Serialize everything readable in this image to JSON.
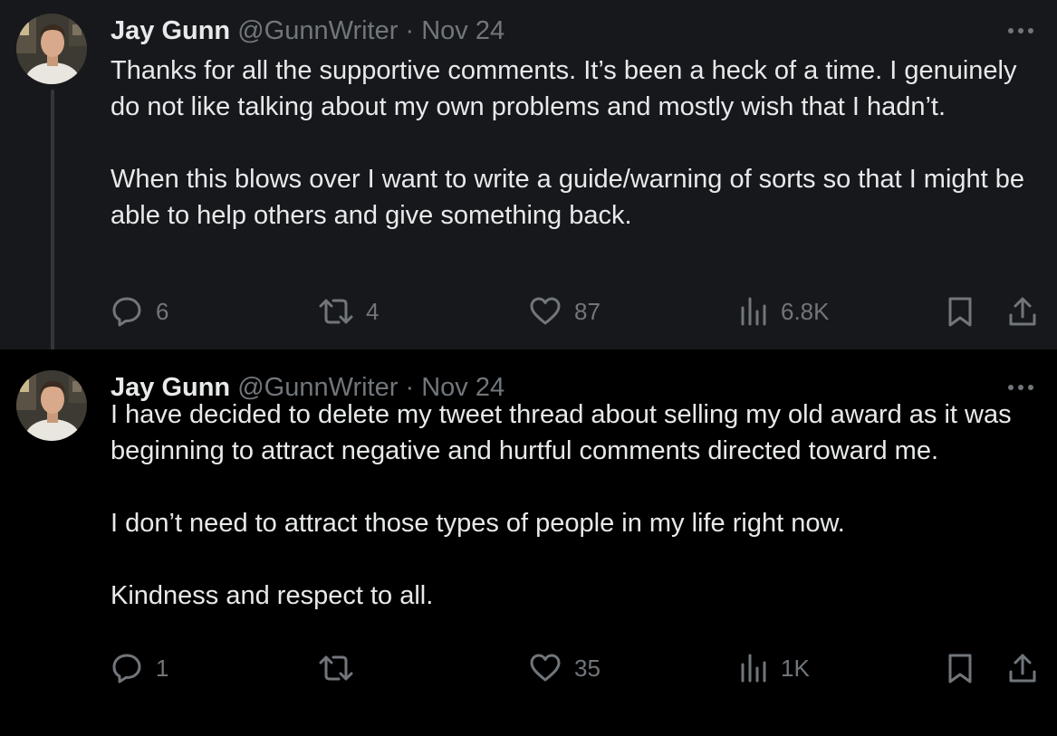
{
  "tweets": [
    {
      "author": {
        "name": "Jay Gunn",
        "handle": "@GunnWriter"
      },
      "separator": "·",
      "date": "Nov 24",
      "paragraphs": [
        "Thanks for all the supportive comments. It’s been a heck of a time. I genuinely do not like talking about my own problems and mostly wish that I hadn’t.",
        "When this blows over I want to write a guide/warning of sorts so that I might be able to help others and give something back."
      ],
      "stats": {
        "replies": "6",
        "retweets": "4",
        "likes": "87",
        "views": "6.8K"
      }
    },
    {
      "author": {
        "name": "Jay Gunn",
        "handle": "@GunnWriter"
      },
      "separator": "·",
      "date": "Nov 24",
      "paragraphs": [
        "I have decided to delete my tweet thread about selling my old award as it was beginning to attract negative and hurtful comments directed toward me.",
        "I don’t need to attract those types of people in my life right now.",
        "Kindness and respect to all."
      ],
      "stats": {
        "replies": "1",
        "retweets": "",
        "likes": "35",
        "views": "1K"
      }
    }
  ],
  "icons": {
    "more": "more-horizontal-icon",
    "reply": "reply-icon",
    "retweet": "retweet-icon",
    "like": "heart-icon",
    "views": "views-icon",
    "bookmark": "bookmark-icon",
    "share": "share-icon"
  },
  "colors": {
    "background": "#000000",
    "thread_background": "#16181c",
    "text_primary": "#e7e9ea",
    "text_secondary": "#71767b",
    "thread_line": "#333639"
  }
}
